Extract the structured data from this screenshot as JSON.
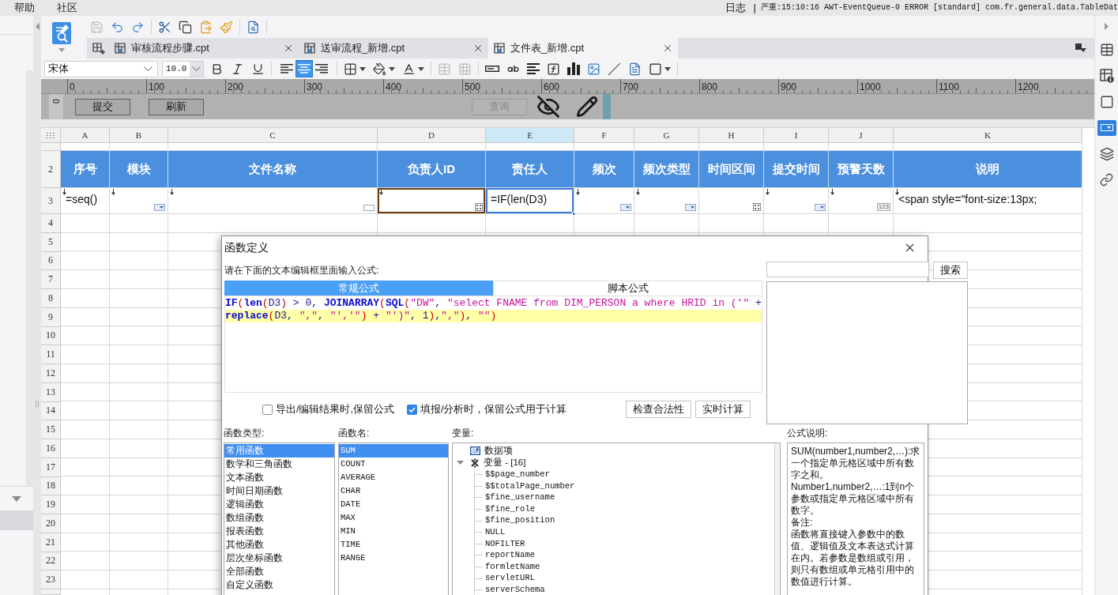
{
  "menu_bar": {
    "items": [
      "帮助",
      "社区"
    ],
    "log_label": "日志",
    "log_separator": "|",
    "log_message": "严重:15:10:16 AWT-EventQueue-0 ERROR [standard] com.fr.general.data.TableDat"
  },
  "left_panel": {
    "items": [
      {
        "selected": true
      }
    ]
  },
  "toolbar": {
    "groups": [
      [
        {
          "kind": "save",
          "disabled": true
        },
        {
          "kind": "undo",
          "disabled": false
        },
        {
          "kind": "redo",
          "disabled": false
        }
      ],
      [
        {
          "kind": "cut",
          "disabled": false
        },
        {
          "kind": "copy",
          "disabled": false
        },
        {
          "kind": "paste",
          "disabled": false
        },
        {
          "kind": "format_painter",
          "disabled": false
        }
      ],
      [
        {
          "kind": "preview",
          "disabled": false
        }
      ]
    ]
  },
  "file_tabs": [
    {
      "label": "审核流程步骤.cpt",
      "selected": false
    },
    {
      "label": "送审流程_新增.cpt",
      "selected": false
    },
    {
      "label": "文件表_新增.cpt",
      "selected": true
    }
  ],
  "format_bar": {
    "font": "宋体",
    "size": "10.0",
    "groups": [
      [
        {
          "kind": "bold",
          "disabled": false
        },
        {
          "kind": "italic",
          "disabled": false
        },
        {
          "kind": "underline",
          "disabled": false
        }
      ],
      [
        {
          "kind": "align_left",
          "selected": false
        },
        {
          "kind": "align_center",
          "selected": true
        },
        {
          "kind": "align_right",
          "selected": false
        }
      ],
      [
        {
          "kind": "border",
          "disabled": false
        },
        {
          "kind": "fill_color",
          "disabled": false
        },
        {
          "kind": "font_color",
          "disabled": false
        }
      ],
      [
        {
          "kind": "merge_cells",
          "disabled": true
        },
        {
          "kind": "split_cells",
          "disabled": true
        }
      ],
      [
        {
          "kind": "text_cell",
          "disabled": false
        },
        {
          "kind": "rich_text",
          "disabled": false
        },
        {
          "kind": "paragraph",
          "disabled": false
        },
        {
          "kind": "formula",
          "disabled": false
        },
        {
          "kind": "chart",
          "disabled": false
        },
        {
          "kind": "image",
          "disabled": false
        },
        {
          "kind": "slash",
          "disabled": false
        },
        {
          "kind": "sub_report",
          "disabled": false
        },
        {
          "kind": "frame",
          "disabled": false
        }
      ]
    ]
  },
  "ruler": {
    "labels": [
      "0",
      "100",
      "200",
      "300",
      "400",
      "500",
      "600",
      "700",
      "800",
      "900",
      "1000",
      "1100",
      "1200"
    ],
    "vertical_label": "0"
  },
  "parameter_panel": {
    "buttons": [
      {
        "label": "提交",
        "disabled": false
      },
      {
        "label": "刷新",
        "disabled": false
      },
      {
        "label": "查询",
        "disabled": true
      }
    ]
  },
  "sheet": {
    "columns": [
      {
        "label": "A",
        "selected": false
      },
      {
        "label": "B",
        "selected": false
      },
      {
        "label": "C",
        "selected": false
      },
      {
        "label": "D",
        "selected": false
      },
      {
        "label": "E",
        "selected": true
      },
      {
        "label": "F",
        "selected": false
      },
      {
        "label": "G",
        "selected": false
      },
      {
        "label": "H",
        "selected": false
      },
      {
        "label": "I",
        "selected": false
      },
      {
        "label": "J",
        "selected": false
      },
      {
        "label": "K",
        "selected": false
      }
    ],
    "header_row": {
      "number": "2",
      "cells": [
        "序号",
        "模块",
        "文件名称",
        "负责人ID",
        "责任人",
        "频次",
        "频次类型",
        "时间区间",
        "提交时间",
        "预警天数",
        "说明"
      ]
    },
    "rows": [
      {
        "number": "3",
        "cells": [
          {
            "kind": "plain",
            "text": "=seq()",
            "expand": true,
            "selected": false,
            "referenced": false
          },
          {
            "kind": "dropdown",
            "expand": true,
            "selected": false,
            "referenced": false
          },
          {
            "kind": "text_field",
            "expand": true,
            "selected": false,
            "referenced": false
          },
          {
            "kind": "grid",
            "expand": true,
            "selected": false,
            "referenced": true
          },
          {
            "kind": "plain",
            "text": "=IF(len(D3)",
            "expand": false,
            "selected": true,
            "referenced": false
          },
          {
            "kind": "dropdown",
            "expand": true,
            "selected": false,
            "referenced": false
          },
          {
            "kind": "dropdown",
            "expand": true,
            "selected": false,
            "referenced": false
          },
          {
            "kind": "grid",
            "expand": false,
            "selected": false,
            "referenced": false
          },
          {
            "kind": "dropdown",
            "expand": true,
            "selected": false,
            "referenced": false
          },
          {
            "kind": "number",
            "widget_text": "123",
            "expand": true,
            "selected": false,
            "referenced": false
          },
          {
            "kind": "plain",
            "text": "<span style=\"font-size:13px;",
            "expand": true,
            "selected": false,
            "referenced": false
          }
        ]
      }
    ],
    "empty_rows": [
      "4",
      "5",
      "6",
      "7",
      "8",
      "9",
      "10",
      "11",
      "12",
      "13",
      "14",
      "15",
      "16",
      "17",
      "18",
      "19",
      "20",
      "21",
      "22",
      "23"
    ]
  },
  "side_tabs": [
    {
      "kind": "cell",
      "selected": false
    },
    {
      "kind": "cell_info",
      "selected": false
    },
    {
      "kind": "frame",
      "selected": false
    },
    {
      "kind": "widget",
      "selected": true
    },
    {
      "kind": "stack",
      "selected": false
    },
    {
      "kind": "link",
      "selected": false
    }
  ],
  "dialog": {
    "title": "函数定义",
    "prompt": "请在下面的文本编辑框里面输入公式:",
    "search_button": "搜索",
    "editor_tabs": [
      {
        "label": "常规公式",
        "selected": true
      },
      {
        "label": "脚本公式",
        "selected": false
      }
    ],
    "formula_lines": [
      {
        "text": "IF(len(D3) > 0, JOINARRAY(SQL(\"DW\", \"select FNAME from DIM_PERSON a where HRID in ('\" +",
        "highlighted": false
      },
      {
        "text": "replace(D3, \",\", \"','\") + \"')\", 1),\",\"), \"\")",
        "highlighted": true
      }
    ],
    "options": [
      {
        "label": "导出/编辑结果时,保留公式",
        "checked": false
      },
      {
        "label": "填报/分析时，保留公式用于计算",
        "checked": true
      }
    ],
    "action_buttons": [
      "检查合法性",
      "实时计算"
    ],
    "function_types": {
      "title": "函数类型:",
      "items": [
        {
          "label": "常用函数",
          "selected": true
        },
        {
          "label": "数学和三角函数",
          "selected": false
        },
        {
          "label": "文本函数",
          "selected": false
        },
        {
          "label": "时间日期函数",
          "selected": false
        },
        {
          "label": "逻辑函数",
          "selected": false
        },
        {
          "label": "数组函数",
          "selected": false
        },
        {
          "label": "报表函数",
          "selected": false
        },
        {
          "label": "其他函数",
          "selected": false
        },
        {
          "label": "层次坐标函数",
          "selected": false
        },
        {
          "label": "全部函数",
          "selected": false
        },
        {
          "label": "自定义函数",
          "selected": false
        }
      ]
    },
    "function_names": {
      "title": "函数名:",
      "items": [
        {
          "label": "SUM",
          "selected": true
        },
        {
          "label": "COUNT",
          "selected": false
        },
        {
          "label": "AVERAGE",
          "selected": false
        },
        {
          "label": "CHAR",
          "selected": false
        },
        {
          "label": "DATE",
          "selected": false
        },
        {
          "label": "MAX",
          "selected": false
        },
        {
          "label": "MIN",
          "selected": false
        },
        {
          "label": "TIME",
          "selected": false
        },
        {
          "label": "RANGE",
          "selected": false
        }
      ]
    },
    "variables": {
      "title": "变量:",
      "items": [
        {
          "kind": "data",
          "label": "数据项",
          "selected": false
        },
        {
          "kind": "group",
          "label": "变量 - [16]",
          "selected": false,
          "expanded": true,
          "children": [
            {
              "label": "$$page_number",
              "selected": false
            },
            {
              "label": "$$totalPage_number",
              "selected": false
            },
            {
              "label": "$fine_username",
              "selected": false
            },
            {
              "label": "$fine_role",
              "selected": false
            },
            {
              "label": "$fine_position",
              "selected": false
            },
            {
              "label": "NULL",
              "selected": false
            },
            {
              "label": "NOFILTER",
              "selected": false
            },
            {
              "label": "reportName",
              "selected": false
            },
            {
              "label": "formletName",
              "selected": false
            },
            {
              "label": "servletURL",
              "selected": false
            },
            {
              "label": "serverSchema",
              "selected": false
            }
          ]
        }
      ]
    },
    "description": {
      "title": "公式说明:",
      "paragraphs": [
        "SUM(number1,number2,…):求一个指定单元格区域中所有数字之和。",
        "Number1,number2,…:1到n个参数或指定单元格区域中所有数字。",
        "备注:",
        "函数将直接键入参数中的数值、逻辑值及文本表达式计算在内。若参数是数组或引用，则只有数组或单元格引用中的数值进行计算。"
      ]
    }
  }
}
